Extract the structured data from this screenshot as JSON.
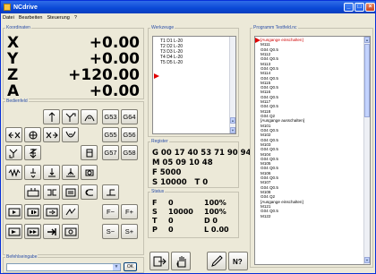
{
  "window": {
    "title": "NCdrive",
    "min": "_",
    "max": "□",
    "close": "×"
  },
  "menu": [
    "Datei",
    "Bearbeiten",
    "Steuerung",
    "?"
  ],
  "coords": {
    "label": "Koordinaten",
    "axes": [
      {
        "axis": "X",
        "value": "+0.00"
      },
      {
        "axis": "Y",
        "value": "+0.00"
      },
      {
        "axis": "Z",
        "value": "+120.00"
      },
      {
        "axis": "A",
        "value": "+0.00"
      }
    ]
  },
  "bedienfeld": {
    "label": "Bedienfeld",
    "gcodes": [
      "G53",
      "G64",
      "G55",
      "G56",
      "G57",
      "G58"
    ],
    "fbtns": [
      "F−",
      "F+",
      "S−",
      "S+"
    ]
  },
  "werkzeuge": {
    "label": "Werkzeuge",
    "items": [
      "T1 D1 L-20",
      "T2 D2 L-20",
      "T3 D3 L-20",
      "T4 D4 L-20",
      "T5 D5 L-20"
    ]
  },
  "register": {
    "label": "Register",
    "lines": [
      "G 00 17 40 53 71 90 94",
      "M 05 09 10 48",
      "F 5000",
      "S 10000   T 0"
    ]
  },
  "status": {
    "label": "Status",
    "rows": [
      [
        "F",
        "0",
        "100%"
      ],
      [
        "S",
        "10000",
        "100%"
      ],
      [
        "T",
        "0",
        "D 0"
      ],
      [
        "P",
        "0",
        "L 0.00"
      ]
    ]
  },
  "programm": {
    "label": "Programm Testfeld.nc",
    "lines": [
      "[Ausgange einschalten]",
      "M111",
      "G04 Q0.5",
      "M112",
      "G04 Q0.5",
      "M113",
      "G04 Q0.5",
      "M114",
      "G04 Q0.5",
      "M115",
      "G04 Q0.5",
      "M116",
      "G04 Q0.5",
      "M117",
      "G04 Q0.5",
      "M118",
      "G04 Q2",
      "[Ausgange ausschalten]",
      "M101",
      "G04 Q0.5",
      "M102",
      "G04 Q0.5",
      "M103",
      "G04 Q0.5",
      "M104",
      "G04 Q0.5",
      "M105",
      "G04 Q0.5",
      "M106",
      "G04 Q0.5",
      "M107",
      "G04 Q0.5",
      "M108",
      "G04 Q2",
      "[Ausgange einschalten]",
      "M121",
      "G04 Q0.5",
      "M122"
    ]
  },
  "eingabe": {
    "label": "Befehlseingabe",
    "ok": "OK"
  },
  "colors": {
    "accent": "#0a48d6",
    "highlight": "#e00000",
    "label": "#2b4fa8"
  }
}
